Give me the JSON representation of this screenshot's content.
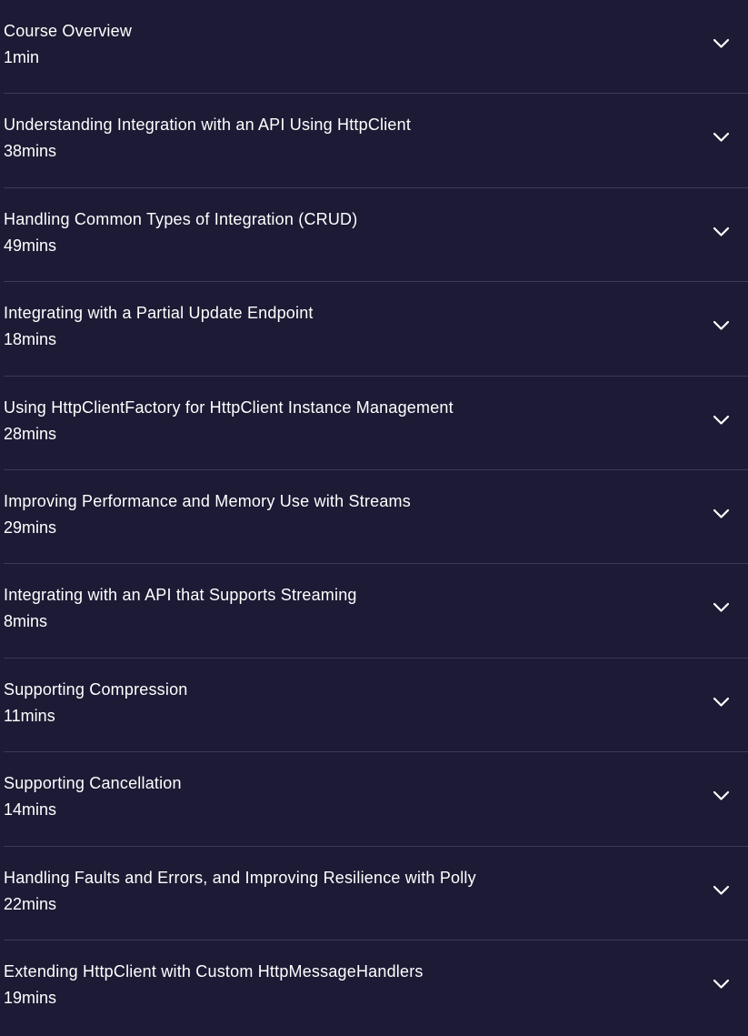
{
  "modules": [
    {
      "title": "Course Overview",
      "duration": "1min"
    },
    {
      "title": "Understanding Integration with an API Using HttpClient",
      "duration": "38mins"
    },
    {
      "title": "Handling Common Types of Integration (CRUD)",
      "duration": "49mins"
    },
    {
      "title": "Integrating with a Partial Update Endpoint",
      "duration": "18mins"
    },
    {
      "title": "Using HttpClientFactory for HttpClient Instance Management",
      "duration": "28mins"
    },
    {
      "title": "Improving Performance and Memory Use with Streams",
      "duration": "29mins"
    },
    {
      "title": "Integrating with an API that Supports Streaming",
      "duration": "8mins"
    },
    {
      "title": "Supporting Compression",
      "duration": "11mins"
    },
    {
      "title": "Supporting Cancellation",
      "duration": "14mins"
    },
    {
      "title": "Handling Faults and Errors, and Improving Resilience with Polly",
      "duration": "22mins"
    },
    {
      "title": "Extending HttpClient with Custom HttpMessageHandlers",
      "duration": "19mins"
    }
  ],
  "icons": {
    "expand": "chevron-down-icon"
  },
  "colors": {
    "background": "#1c1a34",
    "divider": "#3c3a55",
    "text": "#ffffff"
  }
}
